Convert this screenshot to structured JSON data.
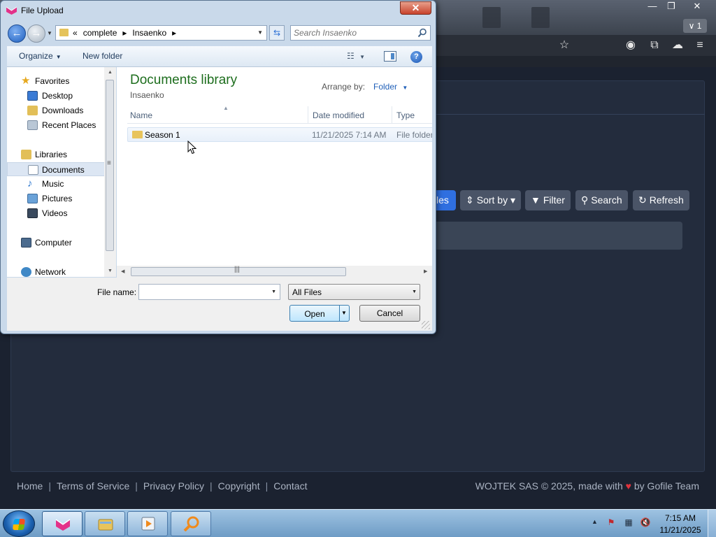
{
  "browser": {
    "tab_count": "1",
    "toolbar": {
      "files_label": "les",
      "sort_label": "Sort by",
      "filter_label": "Filter",
      "search_label": "Search",
      "refresh_label": "Refresh"
    },
    "footer": {
      "links": [
        "Home",
        "Terms of Service",
        "Privacy Policy",
        "Copyright",
        "Contact"
      ],
      "separator": "|",
      "credit_prefix": "WOJTEK SAS © 2025, made with",
      "credit_suffix": "by Gofile Team"
    }
  },
  "dialog": {
    "title": "File Upload",
    "close_glyph": "✕",
    "address": {
      "overflow": "«",
      "crumbs": [
        "complete",
        "Insaenko"
      ],
      "crumb_sep": "▸"
    },
    "search": {
      "placeholder": "Search Insaenko"
    },
    "commands": {
      "organize": "Organize",
      "new_folder": "New folder"
    },
    "nav": {
      "favorites_header": "Favorites",
      "favorites": [
        "Desktop",
        "Downloads",
        "Recent Places"
      ],
      "libraries_header": "Libraries",
      "libraries": [
        "Documents",
        "Music",
        "Pictures",
        "Videos"
      ],
      "computer": "Computer",
      "network": "Network",
      "selected": "Documents"
    },
    "library": {
      "title": "Documents library",
      "subtitle": "Insaenko",
      "arrange_label": "Arrange by:",
      "arrange_value": "Folder"
    },
    "columns": [
      "Name",
      "Date modified",
      "Type"
    ],
    "files": [
      {
        "name": "Season 1",
        "date": "11/21/2025 7:14 AM",
        "type": "File folder"
      }
    ],
    "file_name_label": "File name:",
    "file_name_value": "",
    "filter_value": "All Files",
    "open_label": "Open",
    "cancel_label": "Cancel"
  },
  "taskbar": {
    "time": "7:15 AM",
    "date": "11/21/2025"
  },
  "colors": {
    "library_title": "#1e6e1e",
    "link_blue": "#1f5fb8",
    "accent_blue": "#2f6fe0",
    "heart": "#e0333c"
  }
}
